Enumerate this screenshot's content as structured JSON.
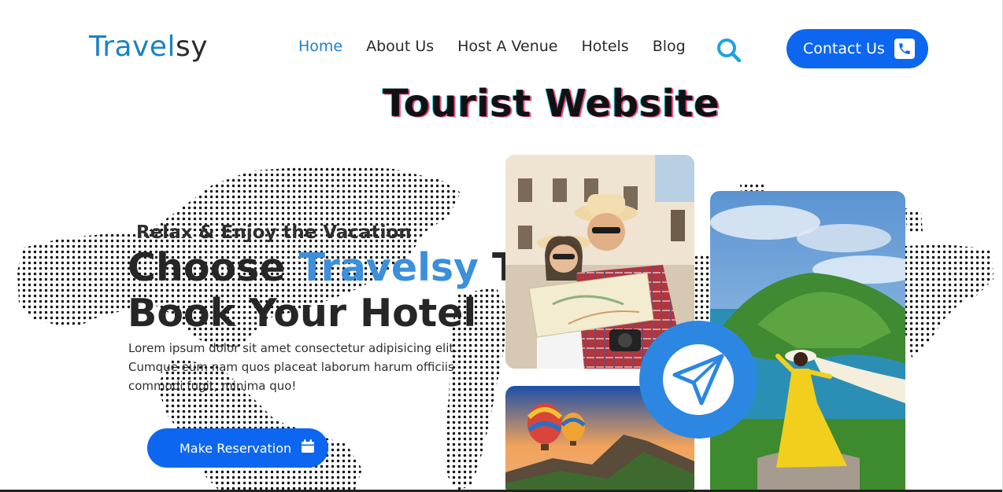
{
  "brand": {
    "logo_part1": "Travel",
    "logo_part2": "sy"
  },
  "nav": {
    "items": [
      {
        "label": "Home",
        "active": true
      },
      {
        "label": "About Us",
        "active": false
      },
      {
        "label": "Host A Venue",
        "active": false
      },
      {
        "label": "Hotels",
        "active": false
      },
      {
        "label": "Blog",
        "active": false
      }
    ],
    "search_icon": "search-icon"
  },
  "contact": {
    "label": "Contact Us",
    "icon": "phone-icon"
  },
  "page_title": "Tourist Website",
  "hero": {
    "tagline": "Relax & Enjoy the Vacation",
    "headline_prefix": "Choose ",
    "headline_accent": "Travelsy",
    "headline_suffix": " To",
    "headline_line2": "Book Your Hotel",
    "description": "Lorem ipsum dolor sit amet consectetur adipisicing elit. Cumque eum nam quos placeat laborum harum officiis commodi fugit, minima quo!",
    "button_label": "Make Reservation",
    "button_icon": "calendar-icon"
  },
  "images": {
    "couple": "couple-with-map-photo",
    "balloons": "hot-air-balloons-photo",
    "island": "tropical-island-photo",
    "send_icon": "paper-plane-icon"
  },
  "colors": {
    "primary": "#0d66f0",
    "accent": "#3b8fdb",
    "logo": "#1a82c4",
    "active_nav": "#1a7fd1"
  }
}
